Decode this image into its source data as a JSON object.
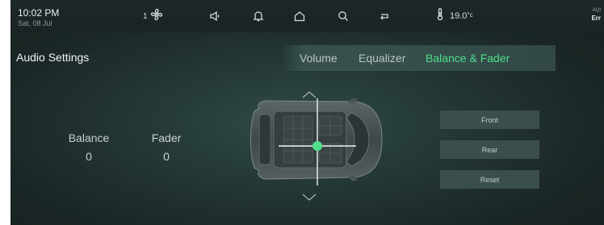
{
  "status_bar": {
    "time": "10:02 PM",
    "date": "Sat, 08 Jul",
    "fan_speed": "1",
    "temperature": "19.0",
    "temperature_unit": "°c",
    "aqi_label": "AQI",
    "aqi_value": "Err",
    "icons": [
      "fan-icon",
      "speaker-icon",
      "bell-icon",
      "home-icon",
      "search-icon",
      "return-icon",
      "thermometer-icon"
    ]
  },
  "page": {
    "title": "Audio Settings"
  },
  "tabs": [
    {
      "label": "Volume",
      "active": false
    },
    {
      "label": "Equalizer",
      "active": false
    },
    {
      "label": "Balance & Fader",
      "active": true
    }
  ],
  "balance": {
    "label": "Balance",
    "value": "0"
  },
  "fader": {
    "label": "Fader",
    "value": "0"
  },
  "controls": {
    "front_label": "Front",
    "rear_label": "Rear",
    "reset_label": "Reset"
  },
  "colors": {
    "accent": "#4fe08a",
    "background": "#1f2e2d",
    "button": "#3a4e4c"
  }
}
